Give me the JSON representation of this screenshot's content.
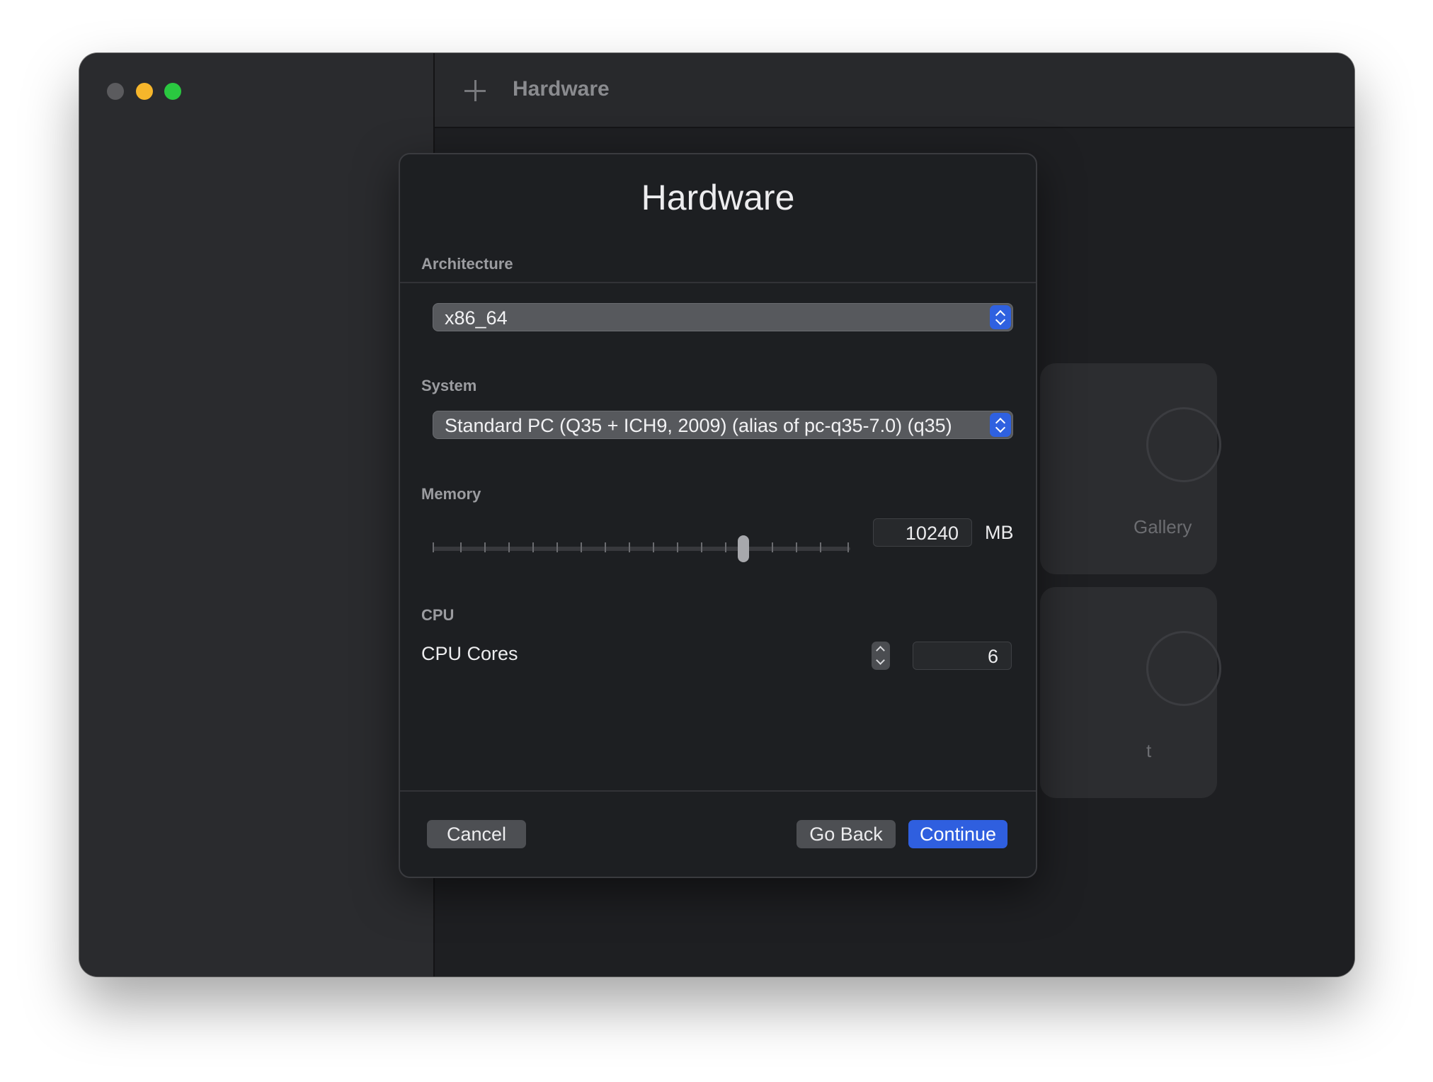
{
  "toolbar": {
    "title": "Hardware"
  },
  "background_cards": [
    {
      "label": "Gallery"
    },
    {
      "label": "t"
    }
  ],
  "dialog": {
    "title": "Hardware",
    "architecture": {
      "label": "Architecture",
      "value": "x86_64"
    },
    "system": {
      "label": "System",
      "value": "Standard PC (Q35 + ICH9, 2009) (alias of pc-q35-7.0) (q35)"
    },
    "memory": {
      "label": "Memory",
      "value": "10240",
      "unit": "MB",
      "slider_fraction": 0.75
    },
    "cpu": {
      "label": "CPU",
      "cores_label": "CPU Cores",
      "cores_value": "6"
    },
    "buttons": {
      "cancel": "Cancel",
      "go_back": "Go Back",
      "continue": "Continue"
    }
  },
  "colors": {
    "accent": "#2f5fdf",
    "traffic_min": "#f6b62b",
    "traffic_max": "#2ac840"
  },
  "icons": [
    "plus-icon",
    "chevron-up-icon",
    "chevron-down-icon"
  ]
}
